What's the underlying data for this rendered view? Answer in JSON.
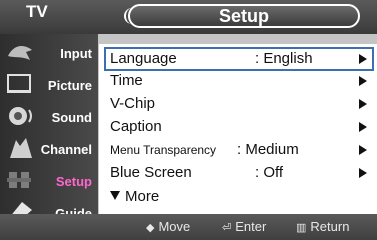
{
  "header": {
    "tv_label": "TV",
    "title": "Setup"
  },
  "sidebar": {
    "items": [
      {
        "label": "Input",
        "icon": "input-icon"
      },
      {
        "label": "Picture",
        "icon": "picture-icon"
      },
      {
        "label": "Sound",
        "icon": "sound-icon"
      },
      {
        "label": "Channel",
        "icon": "channel-icon"
      },
      {
        "label": "Setup",
        "icon": "setup-icon"
      },
      {
        "label": "Guide",
        "icon": "guide-icon"
      }
    ],
    "active_index": 4
  },
  "menu": {
    "items": [
      {
        "label": "Language",
        "value": ": English"
      },
      {
        "label": "Time",
        "value": ""
      },
      {
        "label": "V-Chip",
        "value": ""
      },
      {
        "label": "Caption",
        "value": ""
      },
      {
        "label": "Menu Transparency",
        "value": ": Medium"
      },
      {
        "label": "Blue Screen",
        "value": ": Off"
      }
    ],
    "more_label": "More",
    "selected_index": 0
  },
  "footer": {
    "move_label": "Move",
    "enter_label": "Enter",
    "return_label": "Return"
  },
  "colors": {
    "active_sidebar_label": "#ff66cc",
    "selection_outline": "#3b6fb0"
  }
}
